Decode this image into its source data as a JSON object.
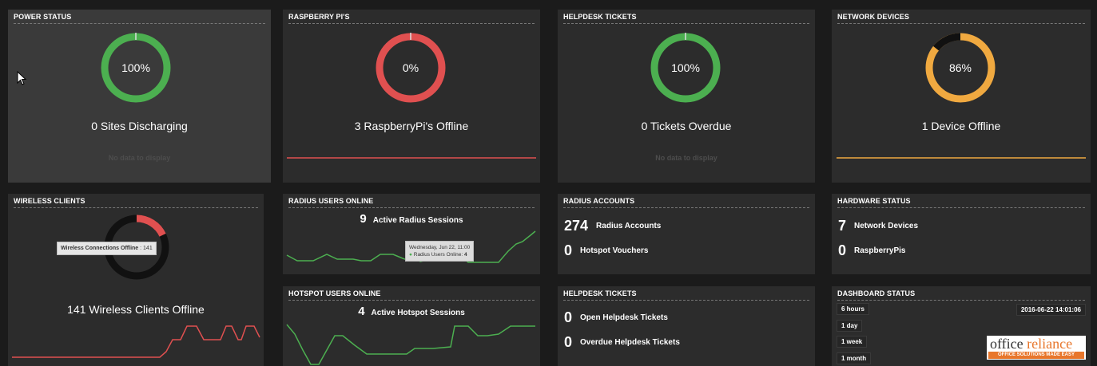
{
  "power": {
    "title": "POWER STATUS",
    "percent": "100%",
    "label": "0 Sites Discharging",
    "nodata": "No data to display"
  },
  "rpi": {
    "title": "RASPBERRY PI'S",
    "percent": "0%",
    "label": "3 RaspberryPi's Offline"
  },
  "helpdesk_top": {
    "title": "HELPDESK TICKETS",
    "percent": "100%",
    "label": "0 Tickets Overdue",
    "nodata": "No data to display"
  },
  "network": {
    "title": "NETWORK DEVICES",
    "percent": "86%",
    "label": "1 Device Offline"
  },
  "wireless": {
    "title": "WIRELESS CLIENTS",
    "tooltip_label": "Wireless Connections Offline",
    "tooltip_value": ": 141",
    "label": "141 Wireless Clients Offline"
  },
  "radius_online": {
    "title": "RADIUS USERS ONLINE",
    "count": "9",
    "count_label": "Active Radius Sessions",
    "tooltip_date": "Wednesday, Jun 22, 11:00",
    "tooltip_series": "Radius Users Online:",
    "tooltip_value": "4"
  },
  "hotspot_online": {
    "title": "HOTSPOT USERS ONLINE",
    "count": "4",
    "count_label": "Active Hotspot Sessions"
  },
  "radius_accounts": {
    "title": "RADIUS ACCOUNTS",
    "accounts_num": "274",
    "accounts_label": "Radius Accounts",
    "vouchers_num": "0",
    "vouchers_label": "Hotspot Vouchers"
  },
  "hardware": {
    "title": "HARDWARE STATUS",
    "net_num": "7",
    "net_label": "Network Devices",
    "rpi_num": "0",
    "rpi_label": "RaspberryPis"
  },
  "helpdesk_bottom": {
    "title": "HELPDESK TICKETS",
    "open_num": "0",
    "open_label": "Open Helpdesk Tickets",
    "overdue_num": "0",
    "overdue_label": "Overdue Helpdesk Tickets"
  },
  "dashboard": {
    "title": "DASHBOARD STATUS",
    "ranges": [
      "6 hours",
      "1 day",
      "1 week",
      "1 month"
    ],
    "timestamp": "2016-06-22 14:01:06",
    "logo_word1": "office",
    "logo_word2": "reliance",
    "logo_tagline": "OFFICE SOLUTIONS MADE EASY"
  },
  "colors": {
    "green": "#4caf50",
    "red": "#e05050",
    "orange": "#f0a940",
    "panel": "#2c2c2c",
    "background": "#1b1b1b"
  },
  "icons": {
    "cursor": "mouse-pointer-icon"
  }
}
